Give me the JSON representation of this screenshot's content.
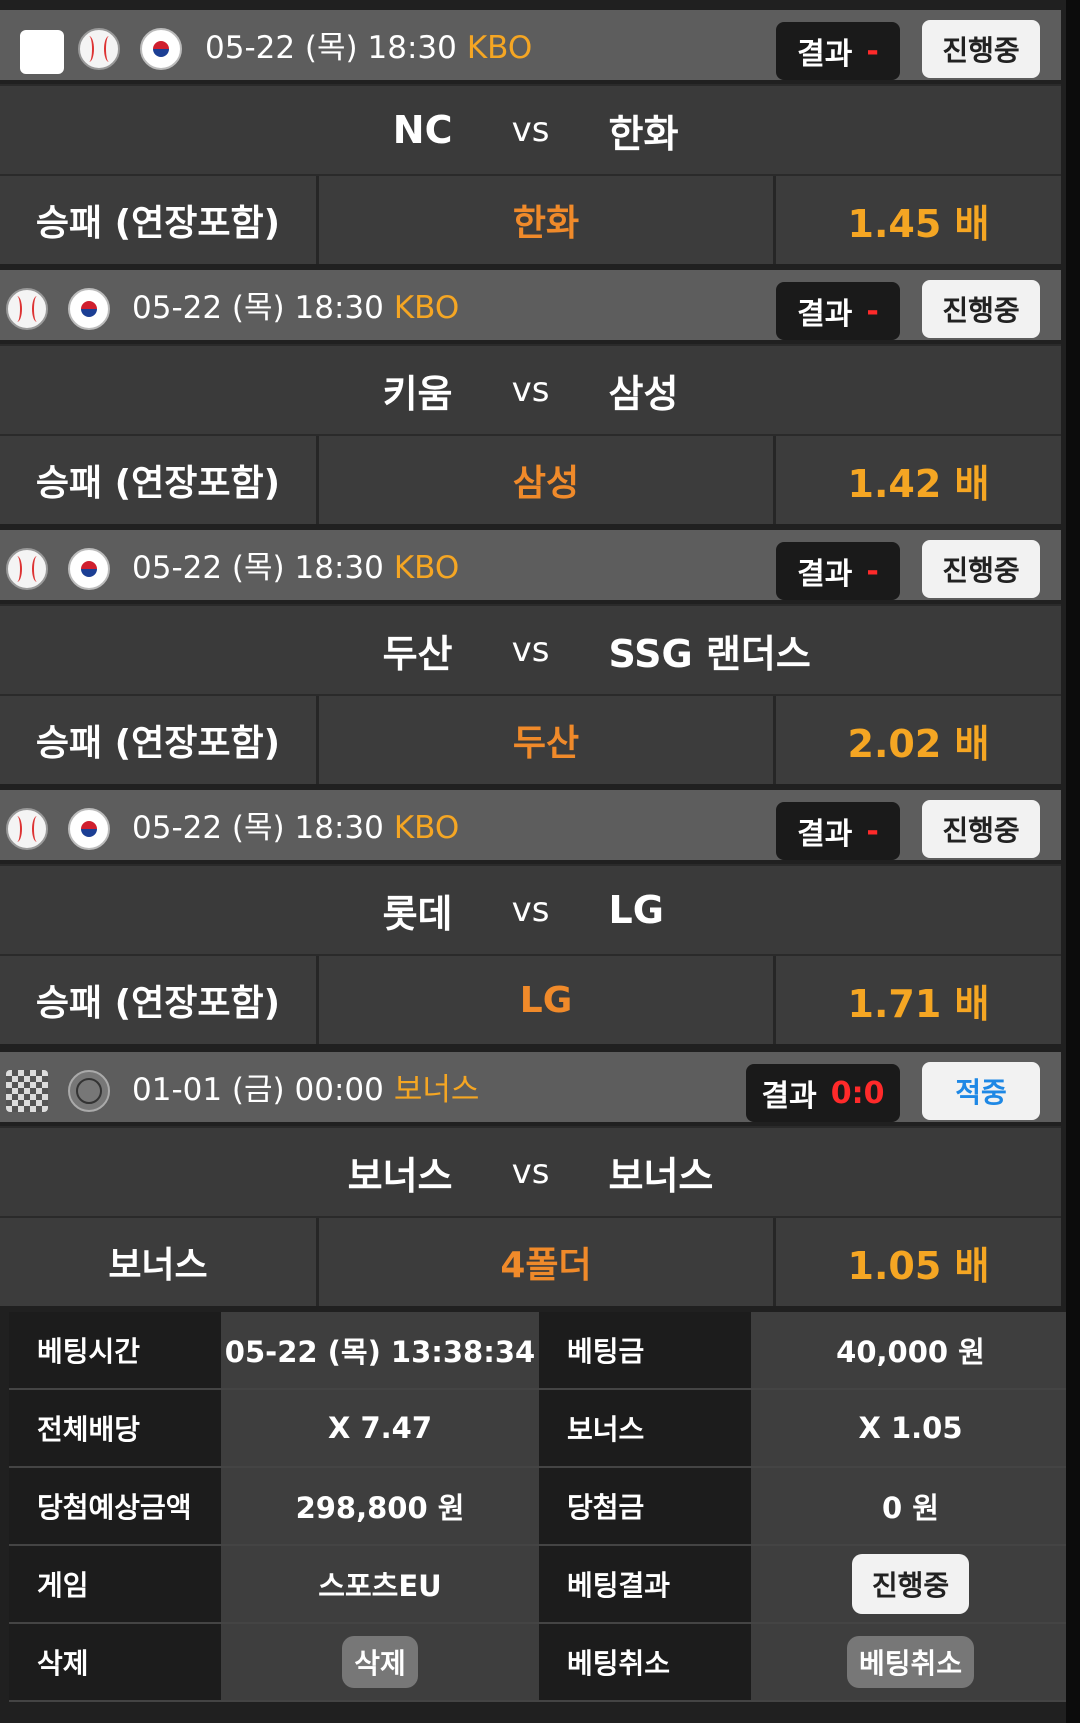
{
  "matches": [
    {
      "date": "05-22 (목) 18:30",
      "league": "KBO",
      "result_label": "결과",
      "result_value": "-",
      "status": "진행중",
      "home": "NC",
      "vs": "vs",
      "away": "한화",
      "market": "승패 (연장포함)",
      "pick": "한화",
      "odds": "1.45 배"
    },
    {
      "date": "05-22 (목) 18:30",
      "league": "KBO",
      "result_label": "결과",
      "result_value": "-",
      "status": "진행중",
      "home": "키움",
      "vs": "vs",
      "away": "삼성",
      "market": "승패 (연장포함)",
      "pick": "삼성",
      "odds": "1.42 배"
    },
    {
      "date": "05-22 (목) 18:30",
      "league": "KBO",
      "result_label": "결과",
      "result_value": "-",
      "status": "진행중",
      "home": "두산",
      "vs": "vs",
      "away": "SSG 랜더스",
      "market": "승패 (연장포함)",
      "pick": "두산",
      "odds": "2.02 배"
    },
    {
      "date": "05-22 (목) 18:30",
      "league": "KBO",
      "result_label": "결과",
      "result_value": "-",
      "status": "진행중",
      "home": "롯데",
      "vs": "vs",
      "away": "LG",
      "market": "승패 (연장포함)",
      "pick": "LG",
      "odds": "1.71 배"
    },
    {
      "date": "01-01 (금) 00:00",
      "league": "보너스",
      "result_label": "결과",
      "result_value": "0:0",
      "status": "적중",
      "home": "보너스",
      "vs": "vs",
      "away": "보너스",
      "market": "보너스",
      "pick": "4폴더",
      "odds": "1.05 배"
    }
  ],
  "bet_info": {
    "bet_time_label": "베팅시간",
    "bet_time": "05-22 (목) 13:38:34",
    "bet_amount_label": "베팅금",
    "bet_amount": "40,000 원",
    "total_odds_label": "전체배당",
    "total_odds": "X 7.47",
    "bonus_label": "보너스",
    "bonus": "X 1.05",
    "expected_label": "당첨예상금액",
    "expected": "298,800 원",
    "win_amount_label": "당첨금",
    "win_amount": "0 원",
    "game_label": "게임",
    "game": "스포츠EU",
    "bet_result_label": "베팅결과",
    "bet_result": "진행중",
    "delete_label": "삭제",
    "delete_button": "삭제",
    "cancel_label": "베팅취소",
    "cancel_button": "베팅취소"
  },
  "icons": {
    "checkbox": "checkbox-icon",
    "sport_baseball": "baseball-icon",
    "flag_korea": "korea-flag-icon",
    "bonus": "bonus-icon",
    "globe": "globe-icon"
  },
  "colors": {
    "league": "#f5a623",
    "pick": "#f08a2a",
    "result_value": "#ff2a2a",
    "hit_status": "#1e88e5"
  }
}
